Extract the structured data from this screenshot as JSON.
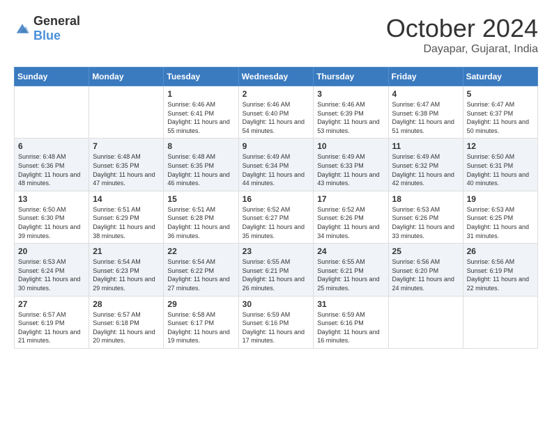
{
  "header": {
    "logo_general": "General",
    "logo_blue": "Blue",
    "month": "October 2024",
    "location": "Dayapar, Gujarat, India"
  },
  "days_of_week": [
    "Sunday",
    "Monday",
    "Tuesday",
    "Wednesday",
    "Thursday",
    "Friday",
    "Saturday"
  ],
  "weeks": [
    [
      {
        "day": "",
        "info": ""
      },
      {
        "day": "",
        "info": ""
      },
      {
        "day": "1",
        "info": "Sunrise: 6:46 AM\nSunset: 6:41 PM\nDaylight: 11 hours and 55 minutes."
      },
      {
        "day": "2",
        "info": "Sunrise: 6:46 AM\nSunset: 6:40 PM\nDaylight: 11 hours and 54 minutes."
      },
      {
        "day": "3",
        "info": "Sunrise: 6:46 AM\nSunset: 6:39 PM\nDaylight: 11 hours and 53 minutes."
      },
      {
        "day": "4",
        "info": "Sunrise: 6:47 AM\nSunset: 6:38 PM\nDaylight: 11 hours and 51 minutes."
      },
      {
        "day": "5",
        "info": "Sunrise: 6:47 AM\nSunset: 6:37 PM\nDaylight: 11 hours and 50 minutes."
      }
    ],
    [
      {
        "day": "6",
        "info": "Sunrise: 6:48 AM\nSunset: 6:36 PM\nDaylight: 11 hours and 48 minutes."
      },
      {
        "day": "7",
        "info": "Sunrise: 6:48 AM\nSunset: 6:35 PM\nDaylight: 11 hours and 47 minutes."
      },
      {
        "day": "8",
        "info": "Sunrise: 6:48 AM\nSunset: 6:35 PM\nDaylight: 11 hours and 46 minutes."
      },
      {
        "day": "9",
        "info": "Sunrise: 6:49 AM\nSunset: 6:34 PM\nDaylight: 11 hours and 44 minutes."
      },
      {
        "day": "10",
        "info": "Sunrise: 6:49 AM\nSunset: 6:33 PM\nDaylight: 11 hours and 43 minutes."
      },
      {
        "day": "11",
        "info": "Sunrise: 6:49 AM\nSunset: 6:32 PM\nDaylight: 11 hours and 42 minutes."
      },
      {
        "day": "12",
        "info": "Sunrise: 6:50 AM\nSunset: 6:31 PM\nDaylight: 11 hours and 40 minutes."
      }
    ],
    [
      {
        "day": "13",
        "info": "Sunrise: 6:50 AM\nSunset: 6:30 PM\nDaylight: 11 hours and 39 minutes."
      },
      {
        "day": "14",
        "info": "Sunrise: 6:51 AM\nSunset: 6:29 PM\nDaylight: 11 hours and 38 minutes."
      },
      {
        "day": "15",
        "info": "Sunrise: 6:51 AM\nSunset: 6:28 PM\nDaylight: 11 hours and 36 minutes."
      },
      {
        "day": "16",
        "info": "Sunrise: 6:52 AM\nSunset: 6:27 PM\nDaylight: 11 hours and 35 minutes."
      },
      {
        "day": "17",
        "info": "Sunrise: 6:52 AM\nSunset: 6:26 PM\nDaylight: 11 hours and 34 minutes."
      },
      {
        "day": "18",
        "info": "Sunrise: 6:53 AM\nSunset: 6:26 PM\nDaylight: 11 hours and 33 minutes."
      },
      {
        "day": "19",
        "info": "Sunrise: 6:53 AM\nSunset: 6:25 PM\nDaylight: 11 hours and 31 minutes."
      }
    ],
    [
      {
        "day": "20",
        "info": "Sunrise: 6:53 AM\nSunset: 6:24 PM\nDaylight: 11 hours and 30 minutes."
      },
      {
        "day": "21",
        "info": "Sunrise: 6:54 AM\nSunset: 6:23 PM\nDaylight: 11 hours and 29 minutes."
      },
      {
        "day": "22",
        "info": "Sunrise: 6:54 AM\nSunset: 6:22 PM\nDaylight: 11 hours and 27 minutes."
      },
      {
        "day": "23",
        "info": "Sunrise: 6:55 AM\nSunset: 6:21 PM\nDaylight: 11 hours and 26 minutes."
      },
      {
        "day": "24",
        "info": "Sunrise: 6:55 AM\nSunset: 6:21 PM\nDaylight: 11 hours and 25 minutes."
      },
      {
        "day": "25",
        "info": "Sunrise: 6:56 AM\nSunset: 6:20 PM\nDaylight: 11 hours and 24 minutes."
      },
      {
        "day": "26",
        "info": "Sunrise: 6:56 AM\nSunset: 6:19 PM\nDaylight: 11 hours and 22 minutes."
      }
    ],
    [
      {
        "day": "27",
        "info": "Sunrise: 6:57 AM\nSunset: 6:19 PM\nDaylight: 11 hours and 21 minutes."
      },
      {
        "day": "28",
        "info": "Sunrise: 6:57 AM\nSunset: 6:18 PM\nDaylight: 11 hours and 20 minutes."
      },
      {
        "day": "29",
        "info": "Sunrise: 6:58 AM\nSunset: 6:17 PM\nDaylight: 11 hours and 19 minutes."
      },
      {
        "day": "30",
        "info": "Sunrise: 6:59 AM\nSunset: 6:16 PM\nDaylight: 11 hours and 17 minutes."
      },
      {
        "day": "31",
        "info": "Sunrise: 6:59 AM\nSunset: 6:16 PM\nDaylight: 11 hours and 16 minutes."
      },
      {
        "day": "",
        "info": ""
      },
      {
        "day": "",
        "info": ""
      }
    ]
  ]
}
